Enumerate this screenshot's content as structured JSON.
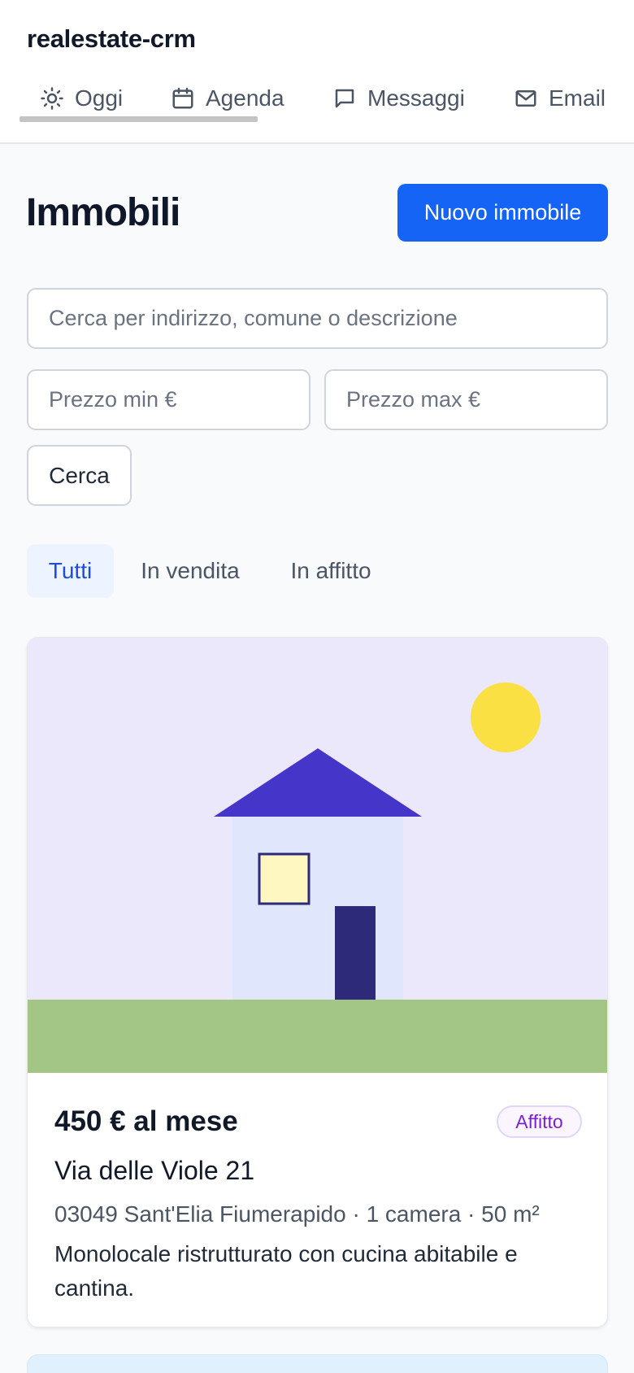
{
  "app": {
    "title": "realestate-crm"
  },
  "nav": {
    "items": [
      {
        "label": "Oggi",
        "icon": "sun-icon",
        "active": true
      },
      {
        "label": "Agenda",
        "icon": "calendar-icon",
        "active": false
      },
      {
        "label": "Messaggi",
        "icon": "message-square-icon",
        "active": false
      },
      {
        "label": "Email",
        "icon": "mail-icon",
        "active": false
      }
    ]
  },
  "page": {
    "title": "Immobili",
    "new_button": "Nuovo immobile"
  },
  "search": {
    "query_placeholder": "Cerca per indirizzo, comune o descrizione",
    "query_value": "",
    "price_min_placeholder": "Prezzo min €",
    "price_max_placeholder": "Prezzo max €",
    "submit_label": "Cerca"
  },
  "filters": {
    "tabs": [
      {
        "label": "Tutti",
        "active": true
      },
      {
        "label": "In vendita",
        "active": false
      },
      {
        "label": "In affitto",
        "active": false
      }
    ]
  },
  "listings": [
    {
      "price": "450 € al mese",
      "badge": "Affitto",
      "address": "Via delle Viole 21",
      "meta": "03049 Sant'Elia Fiumerapido · 1 camera · 50 m²",
      "description": "Monolocale ristrutturato con cucina abitabile e cantina."
    }
  ],
  "colors": {
    "accent": "#1664f5",
    "active_tab_bg": "#eef4ff",
    "active_tab_text": "#1d4ed8",
    "badge_text": "#7e22ce",
    "illustration_sky": "#ebe8fb",
    "illustration_roof": "#4536c9",
    "illustration_ground": "#a3c585",
    "illustration_sun": "#fbe043"
  }
}
